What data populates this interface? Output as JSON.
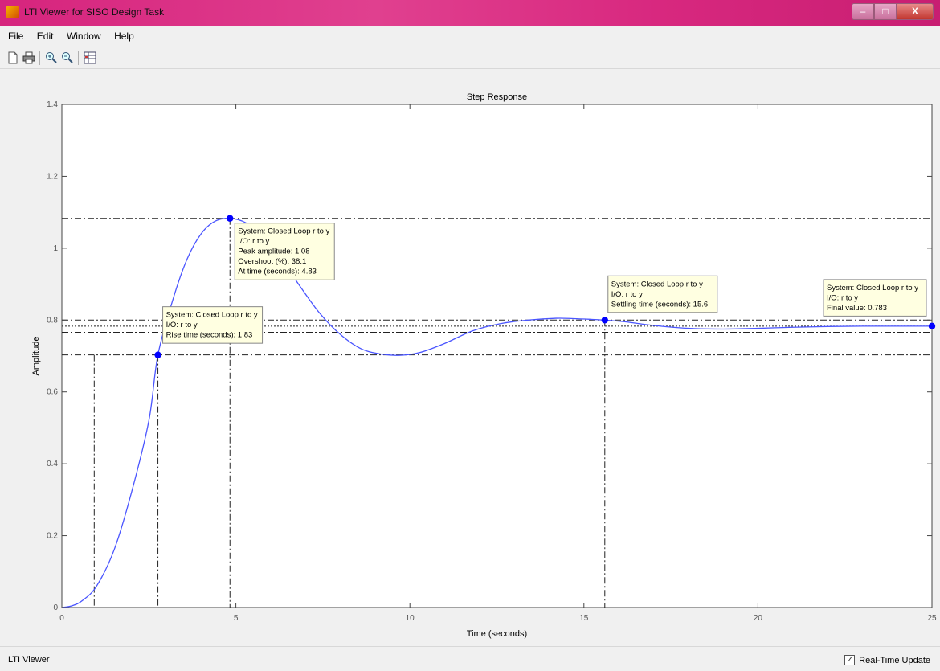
{
  "window": {
    "title": "LTI Viewer for SISO Design Task",
    "min": "–",
    "max": "□",
    "close": "X"
  },
  "menu": [
    "File",
    "Edit",
    "Window",
    "Help"
  ],
  "toolbar": [
    "new-icon",
    "print-icon",
    "zoom-in-icon",
    "zoom-out-icon",
    "grid-icon"
  ],
  "status": {
    "label": "LTI Viewer",
    "realtime_label": "Real-Time Update",
    "realtime_checked": true
  },
  "chart_data": {
    "type": "line",
    "title": "Step Response",
    "xlabel": "Time (seconds)",
    "ylabel": "Amplitude",
    "xlim": [
      0,
      25
    ],
    "ylim": [
      0,
      1.4
    ],
    "xticks": [
      0,
      5,
      10,
      15,
      20,
      25
    ],
    "yticks": [
      0,
      0.2,
      0.4,
      0.6,
      0.8,
      1,
      1.2,
      1.4
    ],
    "ytick_labels": [
      "0",
      "0.2",
      "0.4",
      "0.6",
      "0.8",
      "1",
      "1.2",
      "1.4"
    ],
    "series": [
      {
        "color": "#4a55ff",
        "x": [
          0,
          0.3,
          0.6,
          1.0,
          1.5,
          2.0,
          2.5,
          2.76,
          3.2,
          3.6,
          4.0,
          4.4,
          4.83,
          5.3,
          5.8,
          6.3,
          6.8,
          7.4,
          8.0,
          8.6,
          9.2,
          9.73,
          10.3,
          11.0,
          11.8,
          12.6,
          13.4,
          14.2,
          14.7,
          15.2,
          15.6,
          16.2,
          17.0,
          18.0,
          19.0,
          20.0,
          21.0,
          22.0,
          23.0,
          24.0,
          25.0
        ],
        "y": [
          0,
          0.005,
          0.02,
          0.06,
          0.16,
          0.32,
          0.52,
          0.703,
          0.86,
          0.97,
          1.04,
          1.075,
          1.083,
          1.07,
          1.03,
          0.97,
          0.9,
          0.82,
          0.76,
          0.72,
          0.705,
          0.702,
          0.71,
          0.735,
          0.77,
          0.79,
          0.8,
          0.805,
          0.804,
          0.802,
          0.8,
          0.795,
          0.785,
          0.777,
          0.775,
          0.777,
          0.78,
          0.782,
          0.783,
          0.783,
          0.783
        ]
      }
    ],
    "reference_lines": {
      "h": [
        1.083,
        0.8,
        0.783,
        0.766,
        0.703
      ],
      "v": [
        0.93,
        2.76,
        4.83,
        15.6
      ]
    },
    "markers": [
      {
        "x": 2.76,
        "y": 0.703,
        "lines": [
          "System: Closed Loop r to y",
          "I/O: r to y",
          "Rise time (seconds): 1.83"
        ]
      },
      {
        "x": 4.83,
        "y": 1.083,
        "lines": [
          "System: Closed Loop r to y",
          "I/O: r to y",
          "Peak amplitude: 1.08",
          "Overshoot (%): 38.1",
          "At time (seconds): 4.83"
        ]
      },
      {
        "x": 15.6,
        "y": 0.8,
        "lines": [
          "System: Closed Loop r to y",
          "I/O: r to y",
          "Settling time (seconds): 15.6"
        ]
      },
      {
        "x": 25.0,
        "y": 0.783,
        "lines": [
          "System: Closed Loop r to y",
          "I/O: r to y",
          "Final value: 0.783"
        ]
      }
    ]
  }
}
